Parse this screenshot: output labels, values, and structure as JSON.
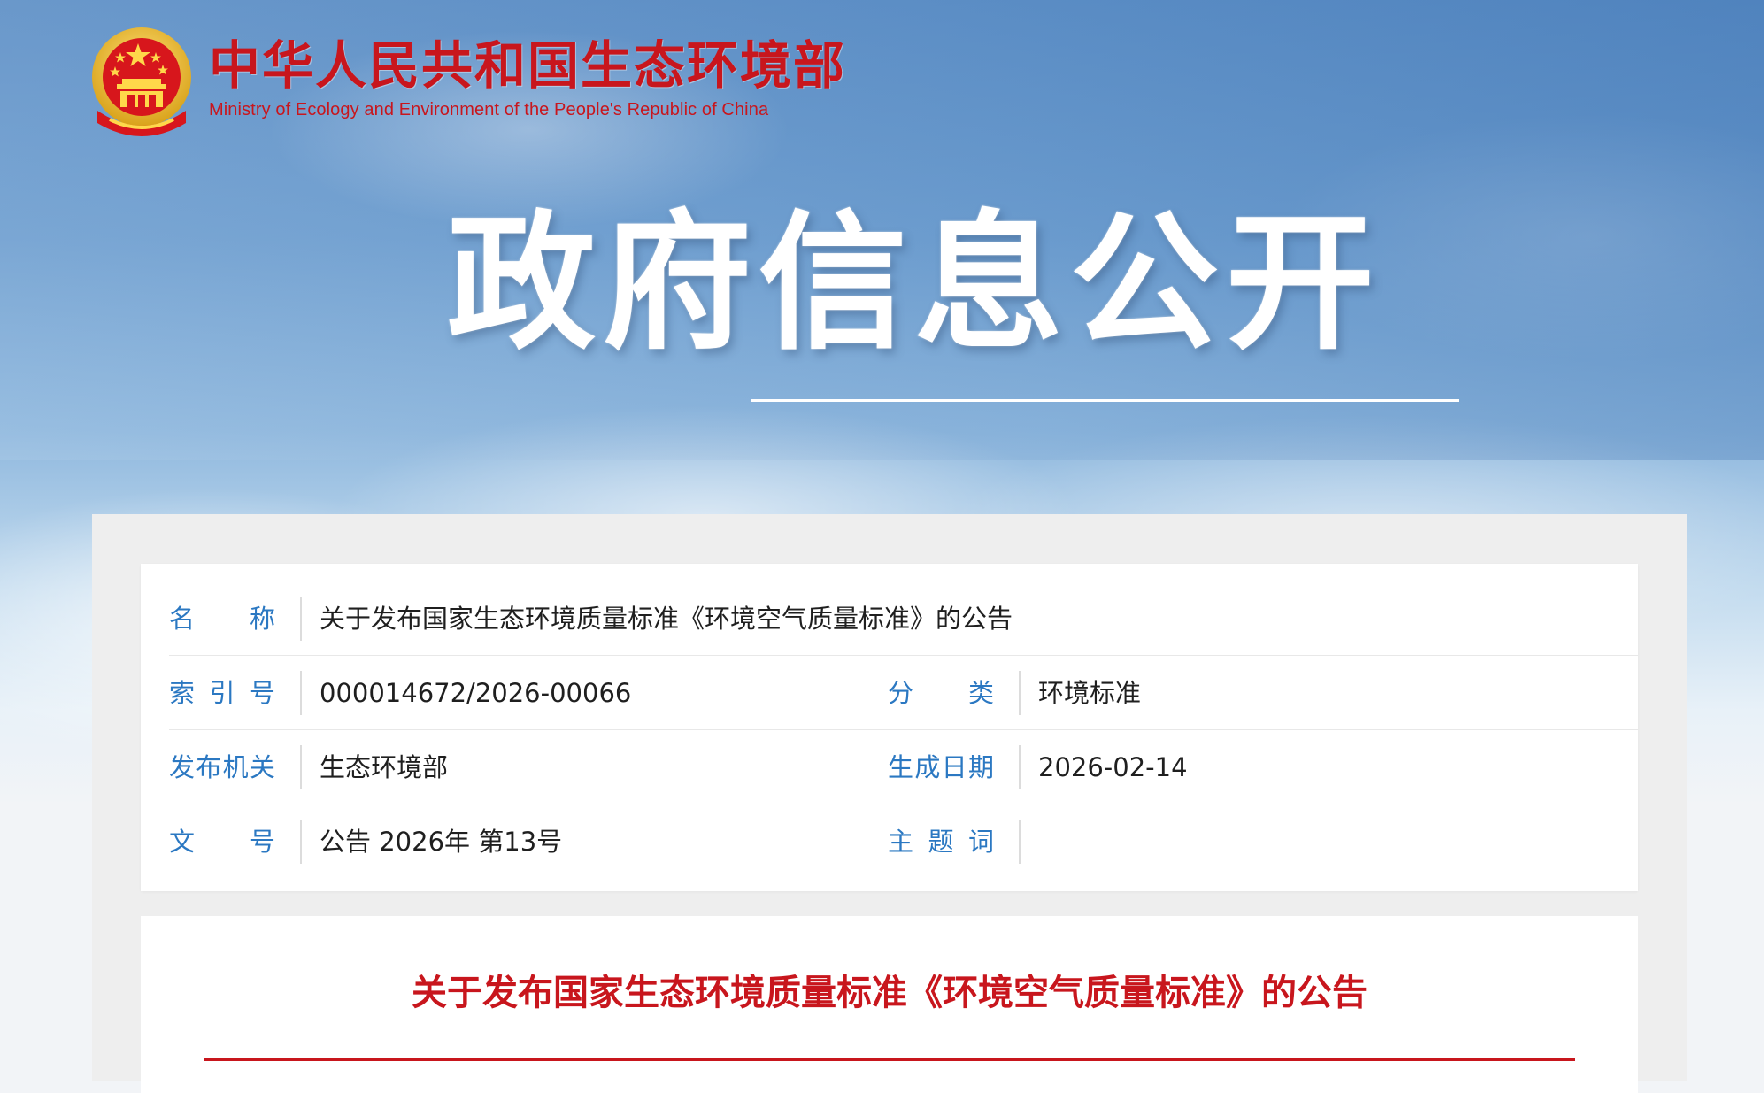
{
  "header": {
    "org_name_cn": "中华人民共和国生态环境部",
    "org_name_en": "Ministry of Ecology and Environment of the People's Republic of China",
    "emblem_icon": "national-emblem-icon"
  },
  "hero": {
    "title": "政府信息公开"
  },
  "info": {
    "rows": [
      {
        "fields": [
          {
            "label": "名　称",
            "value": "关于发布国家生态环境质量标准《环境空气质量标准》的公告"
          }
        ]
      },
      {
        "fields": [
          {
            "label": "索引号",
            "value": "000014672/2026-00066"
          },
          {
            "label": "分　类",
            "value": "环境标准"
          }
        ]
      },
      {
        "fields": [
          {
            "label": "发布机关",
            "value": "生态环境部"
          },
          {
            "label": "生成日期",
            "value": "2026-02-14"
          }
        ]
      },
      {
        "fields": [
          {
            "label": "文　号",
            "value": "公告 2026年 第13号"
          },
          {
            "label": "主题词",
            "value": ""
          }
        ]
      }
    ]
  },
  "article": {
    "title": "关于发布国家生态环境质量标准《环境空气质量标准》的公告"
  },
  "colors": {
    "brand_red": "#c8161d",
    "label_blue": "#2b78c2"
  }
}
